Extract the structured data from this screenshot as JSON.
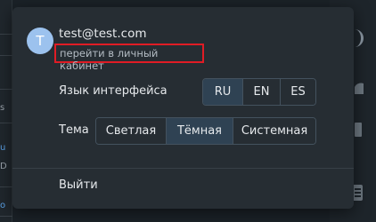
{
  "background": {
    "left_fragments": [
      "s",
      "u",
      "D",
      "o"
    ]
  },
  "user": {
    "avatar_letter": "T",
    "email": "test@test.com",
    "cabinet_link": "перейти в личный кабинет"
  },
  "language": {
    "label": "Язык интерфейса",
    "options": [
      "RU",
      "EN",
      "ES"
    ],
    "selected": "RU"
  },
  "theme": {
    "label": "Тема",
    "options": [
      "Светлая",
      "Тёмная",
      "Системная"
    ],
    "selected": "Тёмная"
  },
  "logout_label": "Выйти",
  "colors": {
    "highlight_border": "#e01c25",
    "active_option": "#2f4253",
    "avatar": "#9cc2ee"
  }
}
